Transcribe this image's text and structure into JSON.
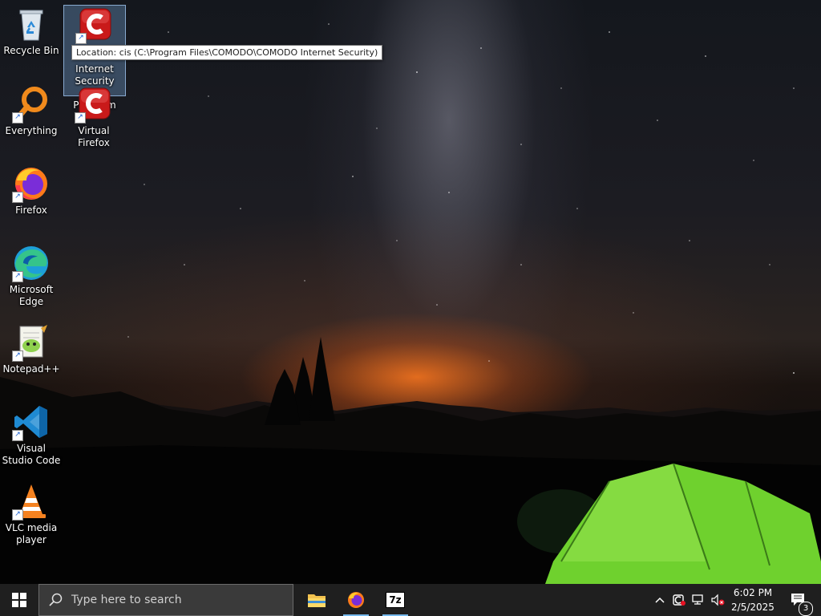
{
  "desktop": {
    "icons": [
      {
        "label": "Recycle Bin",
        "icon": "recycle-bin-icon"
      },
      {
        "label": "Internet Security 2025 Premium",
        "icon": "comodo-icon"
      },
      {
        "label": "Everything",
        "icon": "everything-search-icon"
      },
      {
        "label": "Virtual Firefox",
        "icon": "comodo-icon"
      },
      {
        "label": "Firefox",
        "icon": "firefox-icon"
      },
      {
        "label": "Microsoft Edge",
        "icon": "edge-icon"
      },
      {
        "label": "Notepad++",
        "icon": "notepadplusplus-icon"
      },
      {
        "label": "Visual Studio Code",
        "icon": "vscode-icon"
      },
      {
        "label": "VLC media player",
        "icon": "vlc-icon"
      }
    ],
    "tooltip": "Location: cis (C:\\Program Files\\COMODO\\COMODO Internet Security)"
  },
  "taskbar": {
    "search_placeholder": "Type here to search",
    "pinned": [
      "file-explorer-icon",
      "firefox-icon",
      "7zip-icon"
    ],
    "seven_zip_label": "7z",
    "clock": {
      "time": "6:02 PM",
      "date": "2/5/2025"
    },
    "notification_count": "3"
  },
  "colors": {
    "taskbar": "#1f1f1f",
    "accent": "#76b9ed",
    "comodo_red": "#d81e1e"
  }
}
